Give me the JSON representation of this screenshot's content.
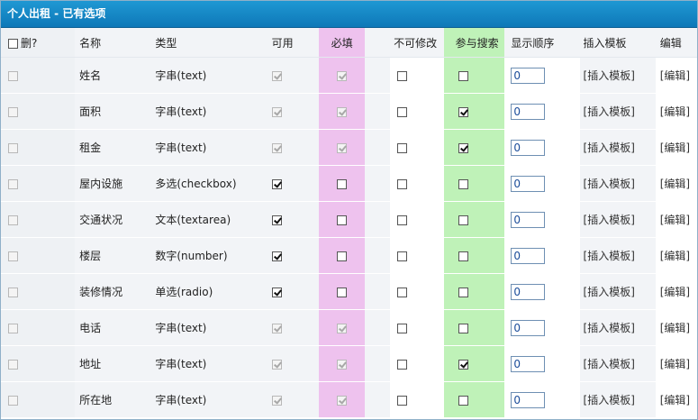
{
  "panel": {
    "title": "个人出租 - 已有选项"
  },
  "headers": {
    "delete": "删?",
    "name": "名称",
    "type": "类型",
    "available": "可用",
    "required": "必填",
    "readonly": "不可修改",
    "search": "参与搜索",
    "order": "显示顺序",
    "insert_template": "插入模板",
    "edit": "编辑"
  },
  "rows": [
    {
      "name": "姓名",
      "type": "字串(text)",
      "available": true,
      "available_disabled": true,
      "required": true,
      "required_disabled": true,
      "readonly": false,
      "search": false,
      "order": "0",
      "insert_template": "[插入模板]",
      "edit": "[编辑]"
    },
    {
      "name": "面积",
      "type": "字串(text)",
      "available": true,
      "available_disabled": true,
      "required": true,
      "required_disabled": true,
      "readonly": false,
      "search": true,
      "order": "0",
      "insert_template": "[插入模板]",
      "edit": "[编辑]"
    },
    {
      "name": "租金",
      "type": "字串(text)",
      "available": true,
      "available_disabled": true,
      "required": true,
      "required_disabled": true,
      "readonly": false,
      "search": true,
      "order": "0",
      "insert_template": "[插入模板]",
      "edit": "[编辑]"
    },
    {
      "name": "屋内设施",
      "type": "多选(checkbox)",
      "available": true,
      "available_disabled": false,
      "required": false,
      "required_disabled": false,
      "readonly": false,
      "search": false,
      "order": "0",
      "insert_template": "[插入模板]",
      "edit": "[编辑]"
    },
    {
      "name": "交通状况",
      "type": "文本(textarea)",
      "available": true,
      "available_disabled": false,
      "required": false,
      "required_disabled": false,
      "readonly": false,
      "search": false,
      "order": "0",
      "insert_template": "[插入模板]",
      "edit": "[编辑]"
    },
    {
      "name": "楼层",
      "type": "数字(number)",
      "available": true,
      "available_disabled": false,
      "required": false,
      "required_disabled": false,
      "readonly": false,
      "search": false,
      "order": "0",
      "insert_template": "[插入模板]",
      "edit": "[编辑]"
    },
    {
      "name": "装修情况",
      "type": "单选(radio)",
      "available": true,
      "available_disabled": false,
      "required": false,
      "required_disabled": false,
      "readonly": false,
      "search": false,
      "order": "0",
      "insert_template": "[插入模板]",
      "edit": "[编辑]"
    },
    {
      "name": "电话",
      "type": "字串(text)",
      "available": true,
      "available_disabled": true,
      "required": true,
      "required_disabled": true,
      "readonly": false,
      "search": false,
      "order": "0",
      "insert_template": "[插入模板]",
      "edit": "[编辑]"
    },
    {
      "name": "地址",
      "type": "字串(text)",
      "available": true,
      "available_disabled": true,
      "required": true,
      "required_disabled": true,
      "readonly": false,
      "search": true,
      "order": "0",
      "insert_template": "[插入模板]",
      "edit": "[编辑]"
    },
    {
      "name": "所在地",
      "type": "字串(text)",
      "available": true,
      "available_disabled": true,
      "required": true,
      "required_disabled": true,
      "readonly": false,
      "search": false,
      "order": "0",
      "insert_template": "[插入模板]",
      "edit": "[编辑]"
    }
  ],
  "colors": {
    "title_bar": "#1589c6",
    "required_column": "#eec2ee",
    "search_column": "#bff2b8",
    "cell_gray": "#f2f4f7"
  }
}
